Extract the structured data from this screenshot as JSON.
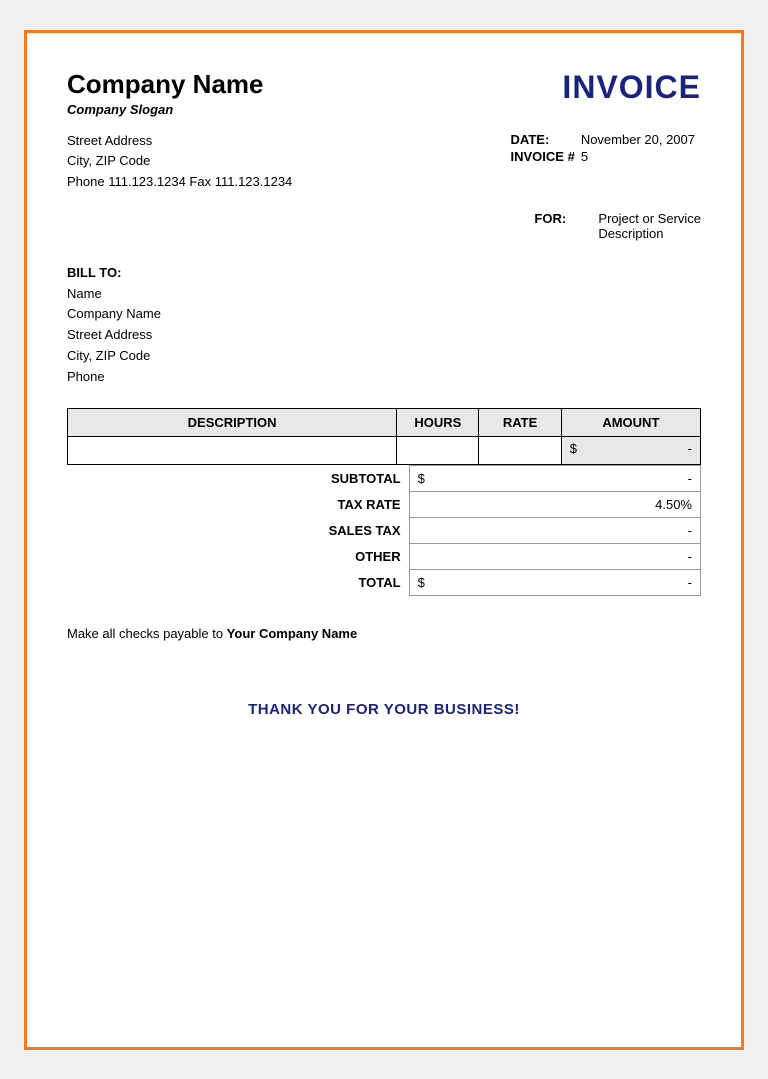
{
  "header": {
    "company_name": "Company Name",
    "slogan": "Company Slogan",
    "invoice_title": "INVOICE"
  },
  "address": {
    "street": "Street Address",
    "city_zip": "City, ZIP Code",
    "phone_fax": "Phone 111.123.1234   Fax 111.123.1234"
  },
  "invoice_meta": {
    "date_label": "DATE:",
    "date_value": "November 20, 2007",
    "invoice_label": "INVOICE #",
    "invoice_value": "5",
    "for_label": "FOR:",
    "for_line1": "Project or Service",
    "for_line2": "Description"
  },
  "bill_to": {
    "label": "BILL TO:",
    "name": "Name",
    "company": "Company Name",
    "street": "Street Address",
    "city_zip": "City, ZIP Code",
    "phone": "Phone"
  },
  "table": {
    "headers": [
      "DESCRIPTION",
      "HOURS",
      "RATE",
      "AMOUNT"
    ],
    "amount_dollar": "$",
    "amount_dash": "-"
  },
  "totals": {
    "subtotal_label": "SUBTOTAL",
    "subtotal_dollar": "$",
    "subtotal_value": "-",
    "tax_rate_label": "TAX RATE",
    "tax_rate_value": "4.50%",
    "sales_tax_label": "SALES TAX",
    "sales_tax_value": "-",
    "other_label": "OTHER",
    "other_value": "-",
    "total_label": "TOTAL",
    "total_dollar": "$",
    "total_value": "-"
  },
  "footer": {
    "note_start": "Make all checks payable to ",
    "note_company": "Your Company Name",
    "thank_you": "THANK YOU FOR YOUR BUSINESS!"
  }
}
